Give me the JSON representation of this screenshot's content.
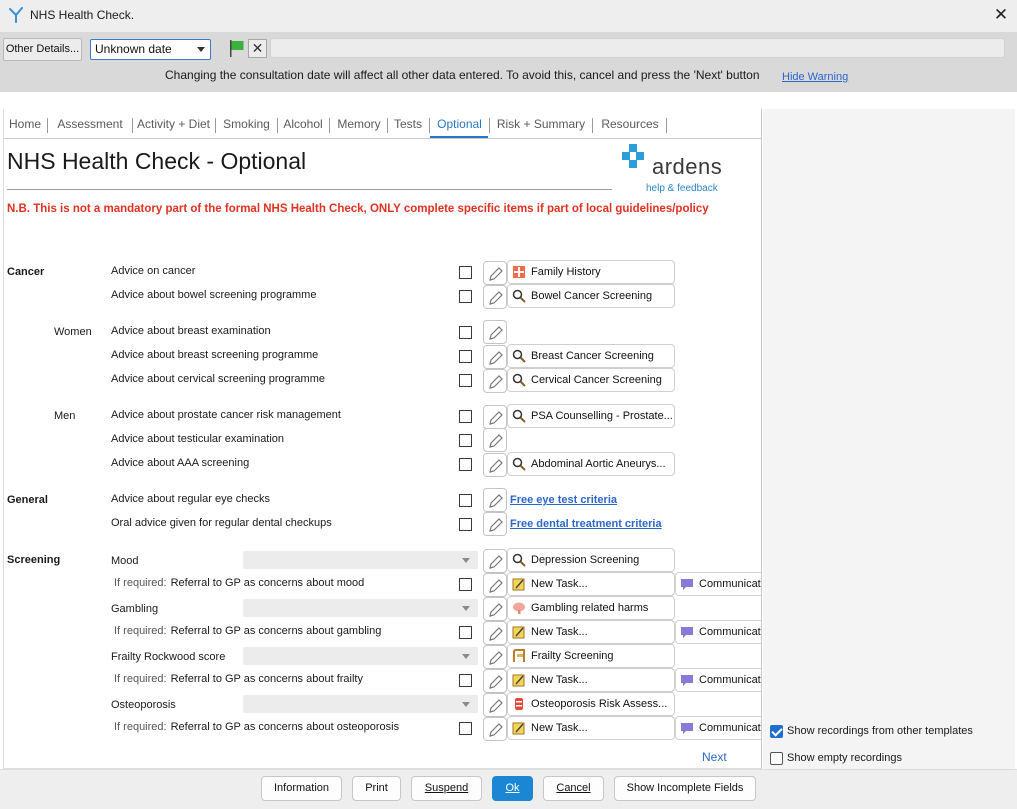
{
  "window": {
    "title": "NHS Health Check."
  },
  "topbar": {
    "other_details_label": "Other Details...",
    "date_value": "Unknown date",
    "warning": "Changing the consultation date will affect all other data entered. To avoid this, cancel and press the 'Next' button",
    "hide_warning": "Hide Warning"
  },
  "tabs": [
    "Home",
    "Assessment",
    "Activity + Diet",
    "Smoking",
    "Alcohol",
    "Memory",
    "Tests",
    "Optional",
    "Risk + Summary",
    "Resources"
  ],
  "active_tab": "Optional",
  "header": {
    "title": "NHS Health Check - Optional",
    "logo_text": "ardens",
    "help_link": "help & feedback",
    "notice": "N.B. This is not a mandatory part of the formal NHS Health Check, ONLY complete specific items if part of local guidelines/policy"
  },
  "sections": {
    "cancer": "Cancer",
    "women": "Women",
    "men": "Men",
    "general": "General",
    "screening": "Screening"
  },
  "rows": {
    "advice_cancer": {
      "label": "Advice on cancer",
      "action": "Family History"
    },
    "advice_bowel": {
      "label": "Advice about bowel screening programme",
      "action": "Bowel Cancer Screening"
    },
    "advice_breast_exam": {
      "label": "Advice about breast examination"
    },
    "advice_breast_screen": {
      "label": "Advice about breast screening programme",
      "action": "Breast Cancer Screening"
    },
    "advice_cervical": {
      "label": "Advice about cervical screening programme",
      "action": "Cervical Cancer Screening"
    },
    "advice_prostate": {
      "label": "Advice about prostate cancer risk management",
      "action": "PSA Counselling - Prostate..."
    },
    "advice_testicular": {
      "label": "Advice about testicular examination"
    },
    "advice_aaa": {
      "label": "Advice about AAA screening",
      "action": "Abdominal Aortic Aneurys..."
    },
    "advice_eye": {
      "label": "Advice about regular eye checks",
      "link": "Free eye test criteria"
    },
    "advice_dental": {
      "label": "Oral advice given for regular dental checkups",
      "link": "Free dental treatment criteria"
    }
  },
  "screening": [
    {
      "label": "Mood",
      "action": "Depression Screening",
      "referral": "Referral to GP as concerns about mood"
    },
    {
      "label": "Gambling",
      "action": "Gambling related harms",
      "referral": "Referral to GP as concerns about gambling"
    },
    {
      "label": "Frailty Rockwood score",
      "action": "Frailty Screening",
      "referral": "Referral to GP as concerns about frailty"
    },
    {
      "label": "Osteoporosis",
      "action": "Osteoporosis Risk Assess...",
      "referral": "Referral to GP as concerns about osteoporosis"
    }
  ],
  "common": {
    "if_required": "If required:",
    "new_task": "New Task...",
    "communicate": "Communicat..."
  },
  "next_label": "Next",
  "options": {
    "show_other": {
      "label": "Show recordings from other templates",
      "checked": true
    },
    "show_empty": {
      "label": "Show empty recordings",
      "checked": false
    }
  },
  "footer": {
    "information": "Information",
    "print": "Print",
    "suspend": "Suspend",
    "ok": "Ok",
    "cancel": "Cancel",
    "show_incomplete": "Show Incomplete Fields"
  },
  "colors": {
    "accent": "#2977c2",
    "notice": "#e13221",
    "primary_button": "#1a86d4",
    "link": "#2b66c9"
  }
}
